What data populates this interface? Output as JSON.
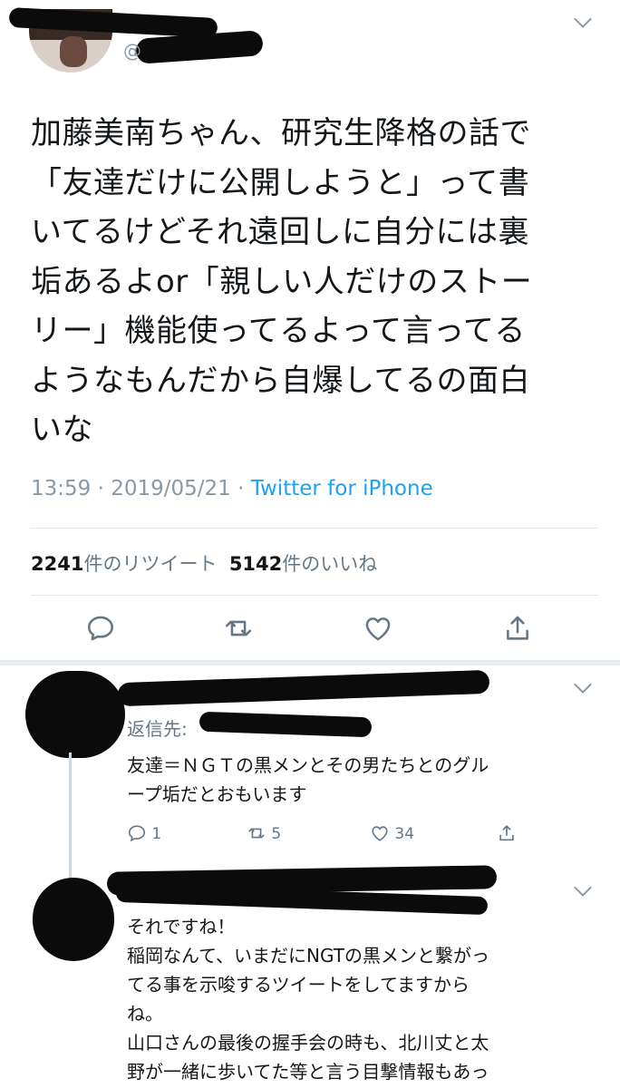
{
  "tweet": {
    "handle_at": "@",
    "text_lines": [
      "加藤美南ちゃん、研究生降格の話で",
      "「友達だけに公開しようと」って書",
      "いてるけどそれ遠回しに自分には裏",
      "垢あるよor「親しい人だけのストー",
      "リー」機能使ってるよって言ってる",
      "ようなもんだから自爆してるの面白",
      "いな"
    ],
    "time": "13:59",
    "date": "2019/05/21",
    "source": "Twitter for iPhone",
    "retweet_count": "2241",
    "retweet_label": "件のリツイート",
    "like_count": "5142",
    "like_label": "件のいいね"
  },
  "replies": [
    {
      "reply_to_label": "返信先:",
      "text_lines": [
        "友達＝ＮＧＴの黒メンとその男たちとのグル",
        "ープ垢だとおもいます"
      ],
      "reply_count": "1",
      "retweet_count": "5",
      "like_count": "34"
    },
    {
      "text_lines": [
        "それですね！",
        "稲岡なんて、いまだにNGTの黒メンと繋がっ",
        "てる事を示唆するツイートをしてますから",
        "ね。",
        "山口さんの最後の握手会の時も、北川丈と太",
        "野が一緒に歩いてた等と言う目撃情報もあっ"
      ]
    }
  ],
  "icons": [
    "reply-icon",
    "retweet-icon",
    "like-icon",
    "share-icon",
    "caret-down-icon"
  ],
  "colors": {
    "link": "#1da1f2",
    "secondary": "#8899a6",
    "text": "#14171a",
    "divider": "#e1e8ed"
  }
}
